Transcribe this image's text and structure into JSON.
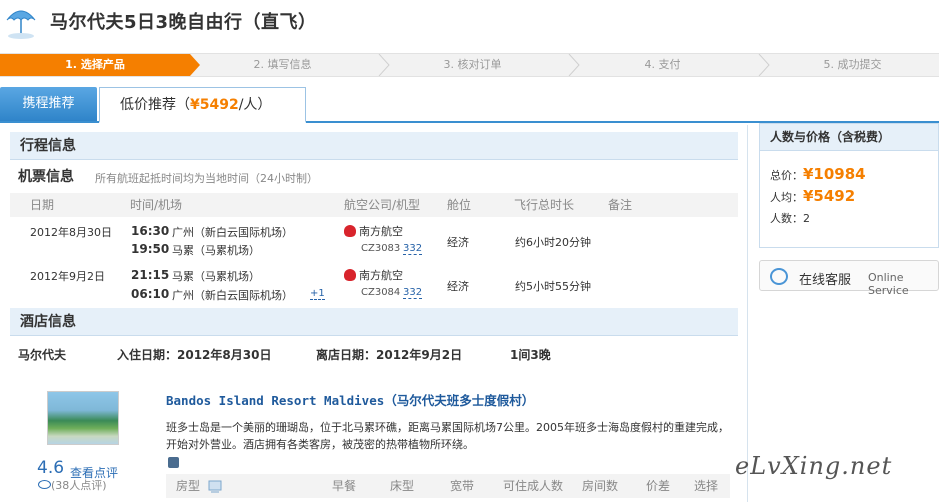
{
  "title": "马尔代夫5日3晚自由行（直飞）",
  "steps": [
    {
      "label": "1. 选择产品",
      "active": true
    },
    {
      "label": "2. 填写信息",
      "active": false
    },
    {
      "label": "3. 核对订单",
      "active": false
    },
    {
      "label": "4. 支付",
      "active": false
    },
    {
      "label": "5. 成功提交",
      "active": false
    }
  ],
  "tabs": {
    "recommend": "携程推荐",
    "low_price_prefix": "低价推荐（",
    "low_price_value": "¥5492",
    "low_price_suffix": "/人）"
  },
  "itinerary": {
    "section_title": "行程信息",
    "flight_title": "机票信息",
    "flight_note": "所有航班起抵时间均为当地时间（24小时制）",
    "columns": [
      "日期",
      "时间/机场",
      "航空公司/机型",
      "舱位",
      "飞行总时长",
      "备注"
    ],
    "flights": [
      {
        "date": "2012年8月30日",
        "dep_time": "16:30",
        "dep_airport": "广州（新白云国际机场）",
        "arr_time": "19:50",
        "arr_airport": "马累（马累机场）",
        "airline": "南方航空",
        "flight_no": "CZ3083",
        "plane": "332",
        "cabin": "经济",
        "duration": "约6小时20分钟",
        "plus_day": ""
      },
      {
        "date": "2012年9月2日",
        "dep_time": "21:15",
        "dep_airport": "马累（马累机场）",
        "arr_time": "06:10",
        "arr_airport": "广州（新白云国际机场）",
        "airline": "南方航空",
        "flight_no": "CZ3084",
        "plane": "332",
        "cabin": "经济",
        "duration": "约5小时55分钟",
        "plus_day": "+1"
      }
    ]
  },
  "hotel": {
    "section_title": "酒店信息",
    "destination": "马尔代夫",
    "checkin": "入住日期：2012年8月30日",
    "checkout": "离店日期：2012年9月2日",
    "nights": "1间3晚",
    "name": "Bandos Island Resort Maldives（马尔代夫班多士度假村）",
    "description": "班多士岛是一个美丽的珊瑚岛，位于北马累环礁，距离马累国际机场7公里。2005年班多士海岛度假村的重建完成，开始对外营业。酒店拥有各类客房，被茂密的热带植物所环绕。",
    "rating": "4.6",
    "rating_link": "查看点评",
    "rating_count": "(38人点评)",
    "room_columns": [
      "房型",
      "早餐",
      "床型",
      "宽带",
      "可住成人数",
      "房间数",
      "价差",
      "选择"
    ]
  },
  "sidebar": {
    "title": "人数与价格（含税费）",
    "total_label": "总价：",
    "total_value": "¥10984",
    "per_label": "人均：",
    "per_value": "¥5492",
    "count_label": "人数：",
    "count_value": "2",
    "service_cn": "在线客服",
    "service_en": "Online Service"
  },
  "watermark": "eLvXing.net",
  "colors": {
    "accent": "#f57f00",
    "link": "#2c6eb5",
    "header_bg": "#e6f0f9",
    "tab_blue": "#3a8fd0"
  }
}
